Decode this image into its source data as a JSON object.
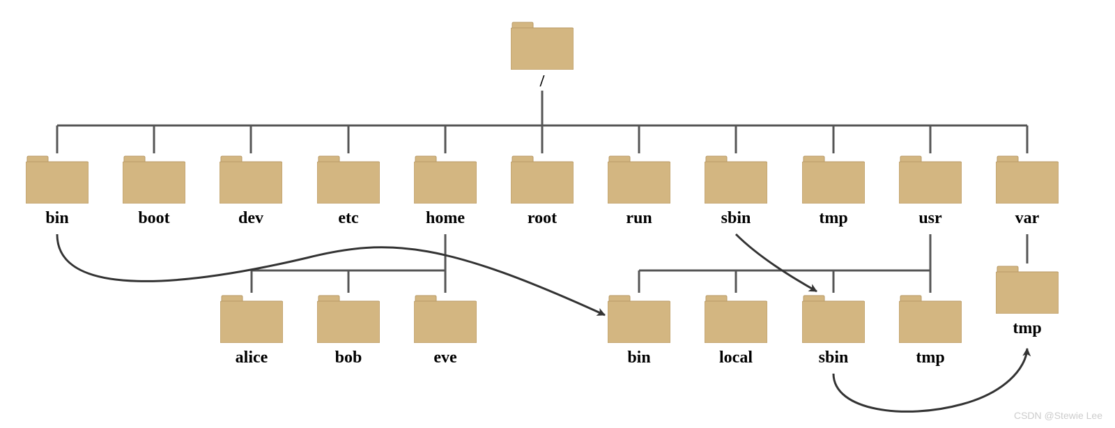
{
  "root": {
    "label": "/"
  },
  "level1": [
    {
      "id": "bin",
      "label": "bin"
    },
    {
      "id": "boot",
      "label": "boot"
    },
    {
      "id": "dev",
      "label": "dev"
    },
    {
      "id": "etc",
      "label": "etc"
    },
    {
      "id": "home",
      "label": "home"
    },
    {
      "id": "root",
      "label": "root"
    },
    {
      "id": "run",
      "label": "run"
    },
    {
      "id": "sbin",
      "label": "sbin"
    },
    {
      "id": "tmp",
      "label": "tmp"
    },
    {
      "id": "usr",
      "label": "usr"
    },
    {
      "id": "var",
      "label": "var"
    }
  ],
  "home_children": [
    {
      "id": "alice",
      "label": "alice"
    },
    {
      "id": "bob",
      "label": "bob"
    },
    {
      "id": "eve",
      "label": "eve"
    }
  ],
  "usr_children": [
    {
      "id": "usr-bin",
      "label": "bin"
    },
    {
      "id": "usr-local",
      "label": "local"
    },
    {
      "id": "usr-sbin",
      "label": "sbin"
    },
    {
      "id": "usr-tmp",
      "label": "tmp"
    }
  ],
  "var_children": [
    {
      "id": "var-tmp",
      "label": "tmp"
    }
  ],
  "symlinks": [
    {
      "from": "bin",
      "to": "usr-bin"
    },
    {
      "from": "sbin",
      "to": "usr-sbin"
    },
    {
      "from": "tmp",
      "to": "var-tmp"
    }
  ],
  "colors": {
    "folder_fill": "#d3b681",
    "folder_stroke": "#b89a66",
    "connector": "#555555",
    "arrow": "#333333"
  },
  "watermark": "CSDN @Stewie Lee"
}
